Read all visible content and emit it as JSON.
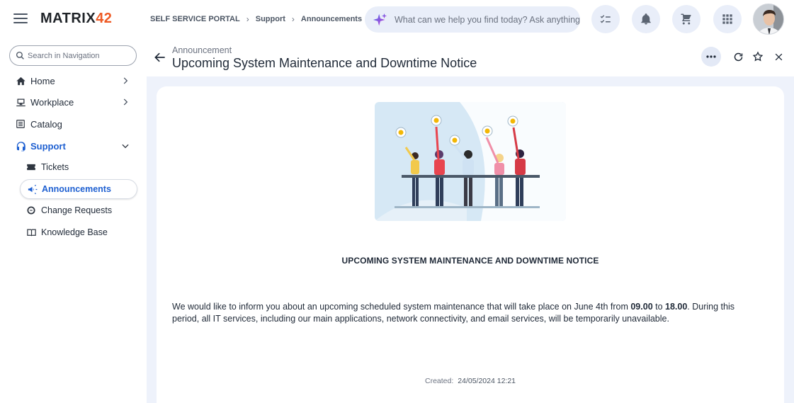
{
  "brand": {
    "logo_main": "MATRIX",
    "logo_accent": "42"
  },
  "breadcrumb": [
    "SELF SERVICE PORTAL",
    "Support",
    "Announcements"
  ],
  "search": {
    "placeholder": "What can we help you find today? Ask anything"
  },
  "sidebar": {
    "search_placeholder": "Search in Navigation",
    "items": [
      {
        "label": "Home",
        "icon": "home-icon",
        "expandable": true
      },
      {
        "label": "Workplace",
        "icon": "computer-icon",
        "expandable": true
      },
      {
        "label": "Catalog",
        "icon": "list-icon",
        "expandable": false
      },
      {
        "label": "Support",
        "icon": "headset-icon",
        "expanded": true
      }
    ],
    "sub_items": [
      {
        "label": "Tickets",
        "icon": "ticket-icon"
      },
      {
        "label": "Announcements",
        "icon": "megaphone-icon",
        "selected": true
      },
      {
        "label": "Change Requests",
        "icon": "change-icon"
      },
      {
        "label": "Knowledge Base",
        "icon": "book-icon"
      }
    ]
  },
  "page": {
    "type": "Announcement",
    "title": "Upcoming System Maintenance and Downtime Notice"
  },
  "announcement": {
    "heading": "UPCOMING SYSTEM MAINTENANCE AND DOWNTIME NOTICE",
    "body_pre": "We would like to inform you about an upcoming scheduled system maintenance that will take place on June 4th from ",
    "time_start": "09.00",
    "body_mid": " to ",
    "time_end": "18.00",
    "body_post": ". During this period, all IT services, including our main applications, network connectivity, and email services, will be temporarily unavailable.",
    "created_label": "Created:",
    "created_value": "24/05/2024 12:21"
  },
  "colors": {
    "accent": "#1d5fd1",
    "brand_orange": "#ee5a24",
    "surface": "#eef2fb"
  }
}
